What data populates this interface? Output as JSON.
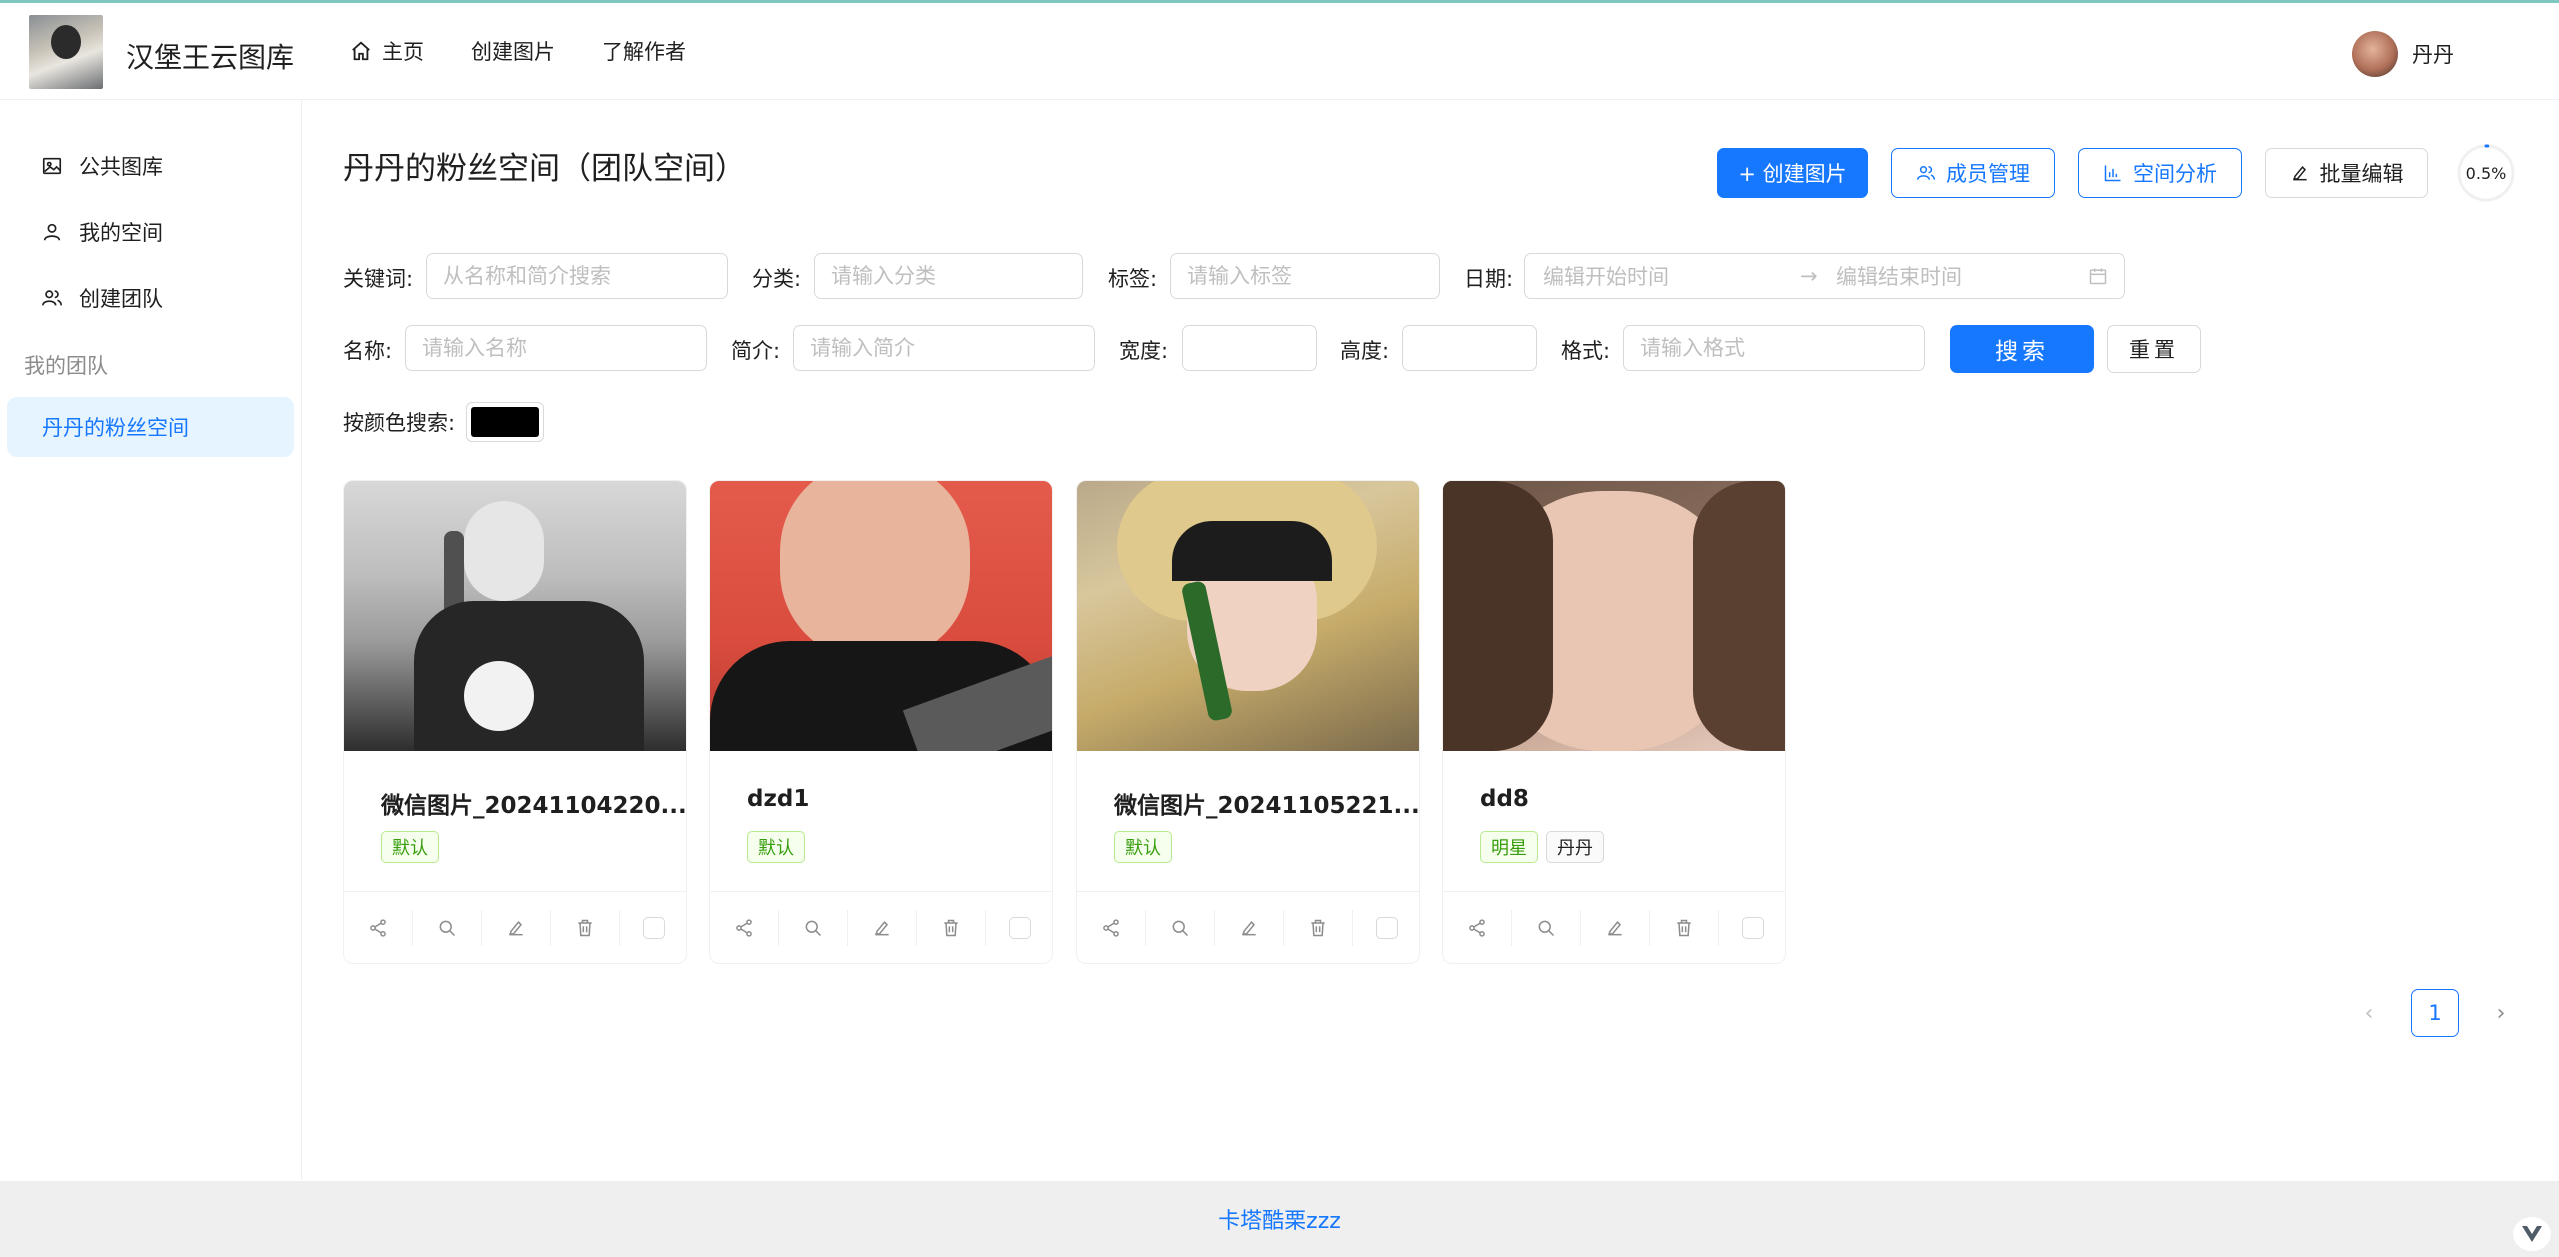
{
  "header": {
    "site_title": "汉堡王云图库",
    "nav": [
      {
        "label": "主页",
        "icon": "home-icon"
      },
      {
        "label": "创建图片"
      },
      {
        "label": "了解作者"
      }
    ],
    "user_name": "丹丹"
  },
  "sidebar": {
    "items": [
      {
        "label": "公共图库",
        "icon": "picture-icon"
      },
      {
        "label": "我的空间",
        "icon": "user-icon"
      },
      {
        "label": "创建团队",
        "icon": "team-icon"
      }
    ],
    "group_label": "我的团队",
    "team_items": [
      {
        "label": "丹丹的粉丝空间",
        "active": true
      }
    ]
  },
  "main": {
    "title": "丹丹的粉丝空间（团队空间）",
    "actions": {
      "create": "+ 创建图片",
      "members": "成员管理",
      "analysis": "空间分析",
      "batch_edit": "批量编辑"
    },
    "usage": {
      "label": "0.5%",
      "percent": 0.5
    }
  },
  "filters": {
    "keyword_label": "关键词:",
    "keyword_placeholder": "从名称和简介搜索",
    "category_label": "分类:",
    "category_placeholder": "请输入分类",
    "tag_label": "标签:",
    "tag_placeholder": "请输入标签",
    "date_label": "日期:",
    "date_start_placeholder": "编辑开始时间",
    "date_arrow": "→",
    "date_end_placeholder": "编辑结束时间",
    "name_label": "名称:",
    "name_placeholder": "请输入名称",
    "intro_label": "简介:",
    "intro_placeholder": "请输入简介",
    "width_label": "宽度:",
    "height_label": "高度:",
    "format_label": "格式:",
    "format_placeholder": "请输入格式",
    "search_button": "搜索",
    "reset_button": "重置",
    "color_label": "按颜色搜索:",
    "color_value": "#000000"
  },
  "cards": [
    {
      "title": "微信图片_20241104220...",
      "tags": [
        {
          "label": "默认",
          "style": "green"
        }
      ]
    },
    {
      "title": "dzd1",
      "tags": [
        {
          "label": "默认",
          "style": "green"
        }
      ]
    },
    {
      "title": "微信图片_20241105221...",
      "tags": [
        {
          "label": "默认",
          "style": "green"
        }
      ]
    },
    {
      "title": "dd8",
      "tags": [
        {
          "label": "明星",
          "style": "green"
        },
        {
          "label": "丹丹",
          "style": "default"
        }
      ]
    }
  ],
  "pagination": {
    "prev": "‹",
    "current": "1",
    "next": "›"
  },
  "footer": {
    "text": "卡塔酷栗zzz"
  },
  "colors": {
    "primary": "#1677ff",
    "active_bg": "#e6f4ff",
    "tag_green": "#389e0d"
  }
}
